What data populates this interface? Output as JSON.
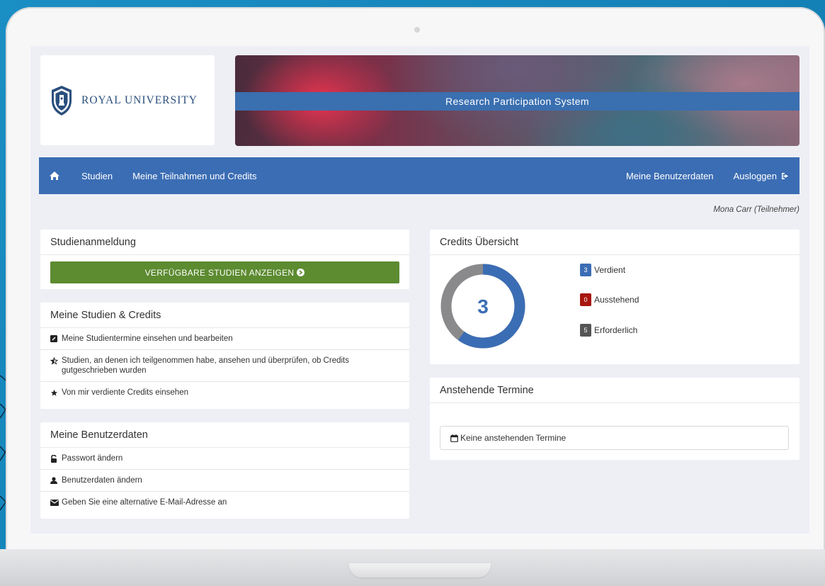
{
  "logo": {
    "name": "ROYAL UNIVERSITY"
  },
  "banner": {
    "title": "Research Participation System"
  },
  "nav": {
    "home_icon": "home-icon",
    "studies": "Studien",
    "participations": "Meine Teilnahmen und Credits",
    "user_data": "Meine Benutzerdaten",
    "logout": "Ausloggen",
    "logout_icon": "sign-out-icon"
  },
  "user": {
    "display": "Mona Carr (Teilnehmer)"
  },
  "study_signup": {
    "title": "Studienanmeldung",
    "button": "VERFÜGBARE STUDIEN ANZEIGEN",
    "button_icon": "chevron-circle-right-icon"
  },
  "my_studies": {
    "title": "Meine Studien & Credits",
    "items": [
      {
        "icon": "edit-icon",
        "label": "Meine Studientermine einsehen und bearbeiten"
      },
      {
        "icon": "star-half-icon",
        "label": "Studien, an denen ich teilgenommen habe, ansehen und überprüfen, ob Credits gutgeschrieben wurden"
      },
      {
        "icon": "star-icon",
        "label": "Von mir verdiente Credits einsehen"
      }
    ]
  },
  "my_user_data": {
    "title": "Meine Benutzerdaten",
    "items": [
      {
        "icon": "unlock-icon",
        "label": "Passwort ändern"
      },
      {
        "icon": "user-icon",
        "label": "Benutzerdaten ändern"
      },
      {
        "icon": "envelope-icon",
        "label": "Geben Sie eine alternative E-Mail-Adresse an"
      }
    ]
  },
  "credits": {
    "title": "Credits Übersicht",
    "center_value": "3",
    "earned": {
      "count": "3",
      "label": "Verdient",
      "color": "#3b6db4"
    },
    "pending": {
      "count": "0",
      "label": "Ausstehend",
      "color": "#a8160f"
    },
    "required": {
      "count": "5",
      "label": "Erforderlich",
      "color": "#555555"
    }
  },
  "appointments": {
    "title": "Anstehende Termine",
    "empty": "Keine anstehenden Termine",
    "icon": "calendar-icon"
  },
  "colors": {
    "nav_blue": "#3b6db4",
    "green_button": "#5c8b30",
    "ring_progress": "#3b6db4",
    "ring_remaining": "#8a8a8c"
  }
}
